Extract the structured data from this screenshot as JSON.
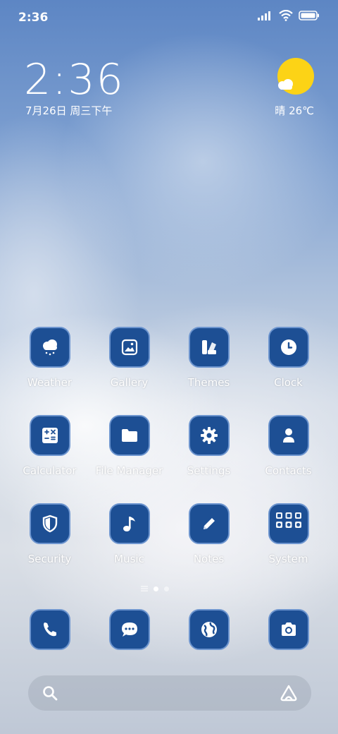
{
  "status_bar": {
    "time": "2:36"
  },
  "lockclock": {
    "time": "2:36",
    "date": "7月26日 周三下午"
  },
  "weather": {
    "text": "晴 26℃"
  },
  "apps": [
    {
      "label": "Weather",
      "icon": "cloud-snow-icon"
    },
    {
      "label": "Gallery",
      "icon": "image-icon"
    },
    {
      "label": "Themes",
      "icon": "themes-icon"
    },
    {
      "label": "Clock",
      "icon": "clock-icon"
    },
    {
      "label": "Calculator",
      "icon": "calculator-icon"
    },
    {
      "label": "File Manager",
      "icon": "folder-icon"
    },
    {
      "label": "Settings",
      "icon": "gear-icon"
    },
    {
      "label": "Contacts",
      "icon": "person-icon"
    },
    {
      "label": "Security",
      "icon": "shield-icon"
    },
    {
      "label": "Music",
      "icon": "music-note-icon"
    },
    {
      "label": "Notes",
      "icon": "pencil-icon"
    },
    {
      "label": "System",
      "icon": "folder-grid-icon"
    }
  ],
  "dock": [
    {
      "icon": "phone-icon"
    },
    {
      "icon": "message-icon"
    },
    {
      "icon": "globe-icon"
    },
    {
      "icon": "camera-icon"
    }
  ],
  "colors": {
    "tile": "#1d4f94",
    "tile_border": "#6d95cf",
    "sun": "#fcd316"
  }
}
